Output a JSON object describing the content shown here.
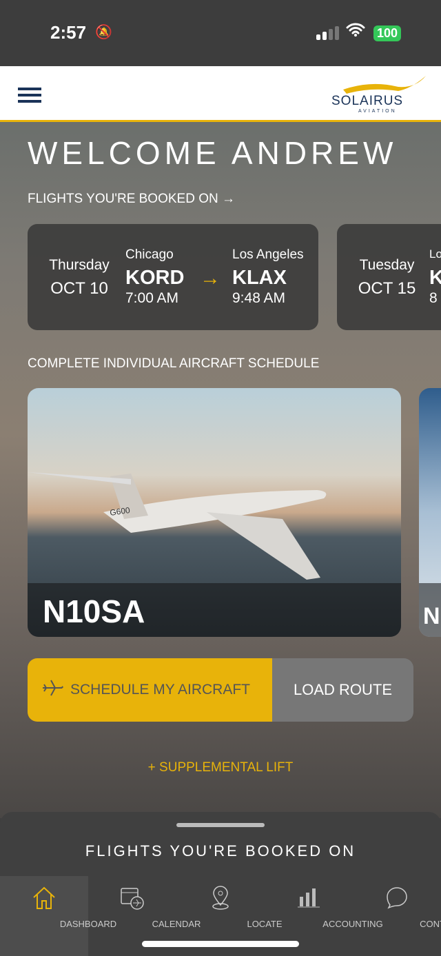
{
  "status": {
    "time": "2:57",
    "battery": "100"
  },
  "header": {
    "logo": "SOLAIRUS",
    "logo_sub": "AVIATION"
  },
  "welcome": "WELCOME ANDREW",
  "flights_section": "FLIGHTS YOU'RE BOOKED ON →",
  "flights": [
    {
      "day": "Thursday",
      "date": "OCT 10",
      "from_city": "Chicago",
      "from_code": "KORD",
      "from_time": "7:00 AM",
      "to_city": "Los Angeles",
      "to_code": "KLAX",
      "to_time": "9:48 AM"
    },
    {
      "day": "Tuesday",
      "date": "OCT 15",
      "from_city": "Lo",
      "from_code": "K",
      "from_time": "8"
    }
  ],
  "schedule_section": "COMPLETE INDIVIDUAL AIRCRAFT SCHEDULE",
  "aircraft": [
    {
      "tail": "N10SA",
      "model": "G600"
    },
    {
      "tail": "N"
    }
  ],
  "buttons": {
    "schedule": "SCHEDULE MY AIRCRAFT",
    "load_route": "LOAD ROUTE",
    "supplemental": "+ SUPPLEMENTAL LIFT"
  },
  "sheet_title": "FLIGHTS YOU'RE BOOKED ON",
  "nav": [
    {
      "label": "DASHBOARD",
      "icon": "home-icon",
      "active": true
    },
    {
      "label": "CALENDAR",
      "icon": "calendar-flight-icon"
    },
    {
      "label": "LOCATE",
      "icon": "location-pin-icon"
    },
    {
      "label": "ACCOUNTING",
      "icon": "bar-chart-icon"
    },
    {
      "label": "CONTACT",
      "icon": "chat-bubble-icon"
    }
  ],
  "colors": {
    "accent": "#e8b30a",
    "brand_navy": "#1a3358"
  }
}
